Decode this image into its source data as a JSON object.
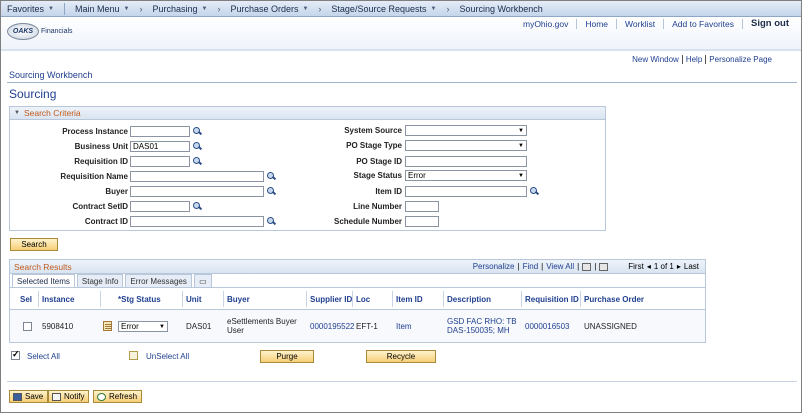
{
  "topnav": {
    "favorites": "Favorites",
    "main_menu": "Main Menu",
    "breadcrumb": [
      "Purchasing",
      "Purchase Orders",
      "Stage/Source Requests",
      "Sourcing Workbench"
    ],
    "separator": "›"
  },
  "header": {
    "logo_mark": "OAKS",
    "logo_text": "Financials",
    "links": [
      "myOhio.gov",
      "Home",
      "Worklist",
      "Add to Favorites",
      "Sign out"
    ]
  },
  "page_links": [
    "New Window",
    "Help",
    "Personalize Page"
  ],
  "crumb_title": "Sourcing Workbench",
  "page_title": "Sourcing",
  "criteria": {
    "title": "Search Criteria",
    "fields": {
      "process_instance": {
        "label": "Process Instance",
        "value": ""
      },
      "business_unit": {
        "label": "Business Unit",
        "value": "DAS01"
      },
      "requisition_id": {
        "label": "Requisition ID",
        "value": ""
      },
      "requisition_name": {
        "label": "Requisition Name",
        "value": ""
      },
      "buyer": {
        "label": "Buyer",
        "value": ""
      },
      "contract_setid": {
        "label": "Contract SetID",
        "value": ""
      },
      "contract_id": {
        "label": "Contract ID",
        "value": ""
      },
      "system_source": {
        "label": "System Source",
        "value": ""
      },
      "po_stage_type": {
        "label": "PO Stage Type",
        "value": ""
      },
      "po_stage_id": {
        "label": "PO Stage ID",
        "value": ""
      },
      "stage_status": {
        "label": "Stage Status",
        "value": "Error"
      },
      "item_id": {
        "label": "Item ID",
        "value": ""
      },
      "line_number": {
        "label": "Line Number",
        "value": ""
      },
      "schedule_number": {
        "label": "Schedule Number",
        "value": ""
      }
    },
    "search_button": "Search"
  },
  "results": {
    "title": "Search Results",
    "toolbar": {
      "personalize": "Personalize",
      "find": "Find",
      "view_all": "View All",
      "first": "First",
      "range": "1 of 1",
      "last": "Last"
    },
    "tabs": [
      "Selected Items",
      "Stage Info",
      "Error Messages"
    ],
    "columns": [
      "Sel",
      "Instance",
      "*Stg Status",
      "Unit",
      "Buyer",
      "Supplier ID",
      "Loc",
      "Item ID",
      "Description",
      "Requisition ID",
      "Purchase Order"
    ],
    "rows": [
      {
        "sel": false,
        "instance": "5908410",
        "stg_status": "Error",
        "unit": "DAS01",
        "buyer": "eSettlements Buyer User",
        "supplier_id": "0000195522",
        "loc": "EFT-1",
        "item_id": "Item",
        "description": "GSD FAC RHO: TB DAS-150035; MH",
        "requisition_id": "0000016503",
        "purchase_order": "UNASSIGNED"
      }
    ]
  },
  "actions": {
    "select_all": "Select All",
    "unselect_all": "UnSelect All",
    "purge": "Purge",
    "recycle": "Recycle"
  },
  "toolbar": {
    "save": "Save",
    "notify": "Notify",
    "refresh": "Refresh"
  }
}
